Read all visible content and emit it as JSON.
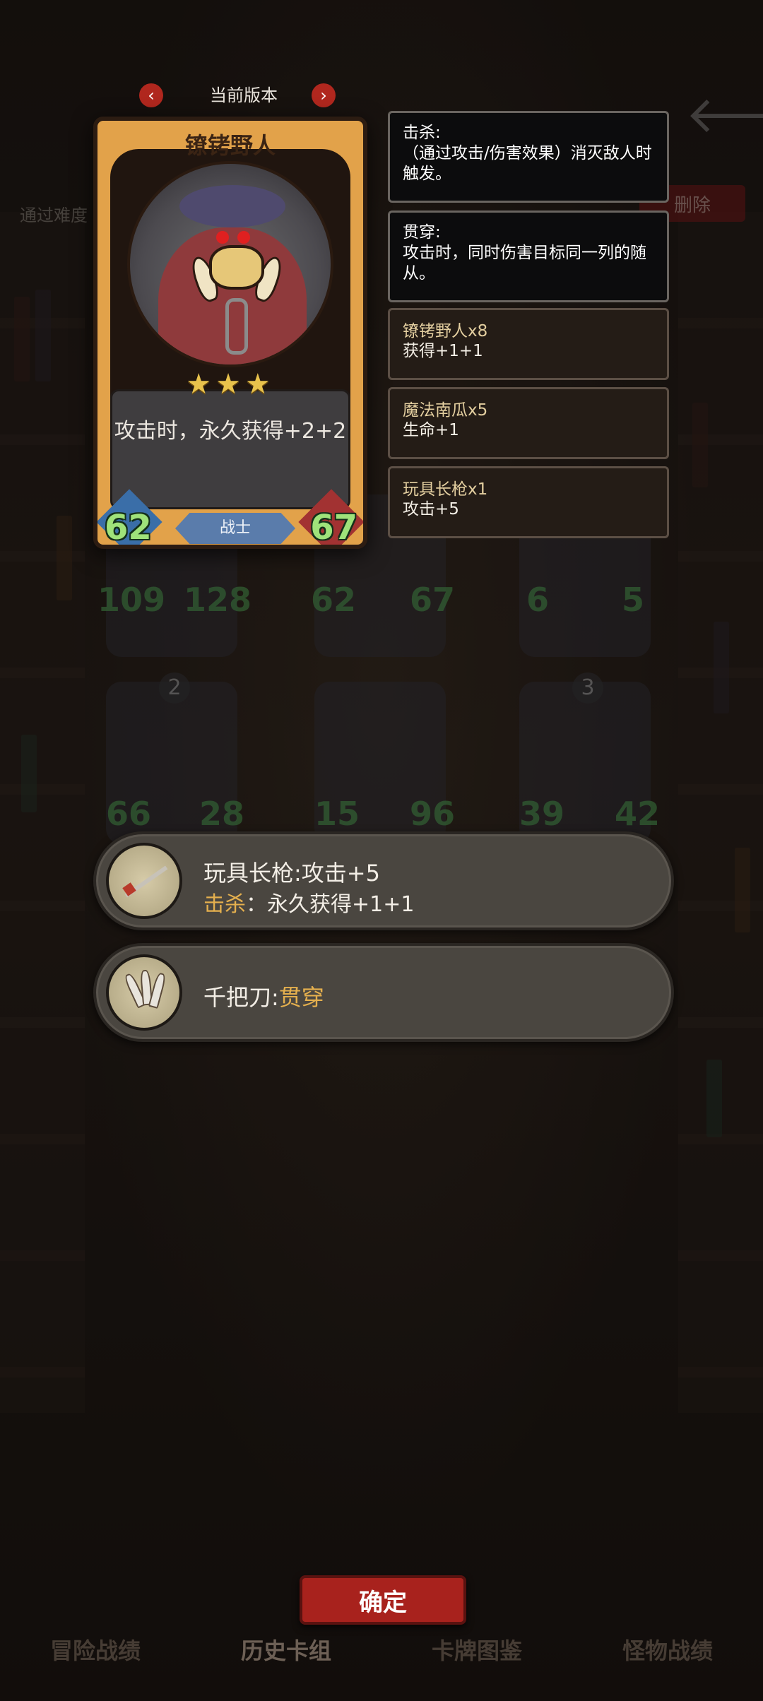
{
  "version_nav": {
    "title": "当前版本",
    "prev_icon": "‹",
    "next_icon": "›"
  },
  "background": {
    "hint_text": "通过难度",
    "delete_label": "删除",
    "back_icon": "🡐",
    "mini_cards": [
      {
        "atk": "109",
        "hp": "128"
      },
      {
        "atk": "62",
        "hp": "67"
      },
      {
        "atk": "6",
        "hp": "5"
      },
      {
        "rank": "2",
        "atk": "66",
        "hp": "28"
      },
      {
        "atk": "15",
        "hp": "96"
      },
      {
        "rank": "3",
        "atk": "39",
        "hp": "42"
      }
    ]
  },
  "card": {
    "name": "镣铐野人",
    "stars": "★★★",
    "description": "攻击时，永久获得+2+2",
    "attack": "62",
    "health": "67",
    "class": "战士"
  },
  "tooltips": [
    {
      "title": "击杀:",
      "body": "（通过攻击/伤害效果）消灭敌人时触发。"
    },
    {
      "title": "贯穿:",
      "body": "攻击时，同时伤害目标同一列的随从。"
    }
  ],
  "sources": [
    {
      "name": "镣铐野人x8",
      "effect": "获得+1+1"
    },
    {
      "name": "魔法南瓜x5",
      "effect": "生命+1"
    },
    {
      "name": "玩具长枪x1",
      "effect": "攻击+5"
    }
  ],
  "items": [
    {
      "name": "玩具长枪:攻击+5",
      "keyword": "击杀",
      "effect": "：永久获得+1+1"
    },
    {
      "name_prefix": "千把刀:",
      "keyword": "贯穿"
    }
  ],
  "confirm_label": "确定",
  "bottom_tabs": [
    "冒险战绩",
    "历史卡组",
    "卡牌图鉴",
    "怪物战绩"
  ]
}
